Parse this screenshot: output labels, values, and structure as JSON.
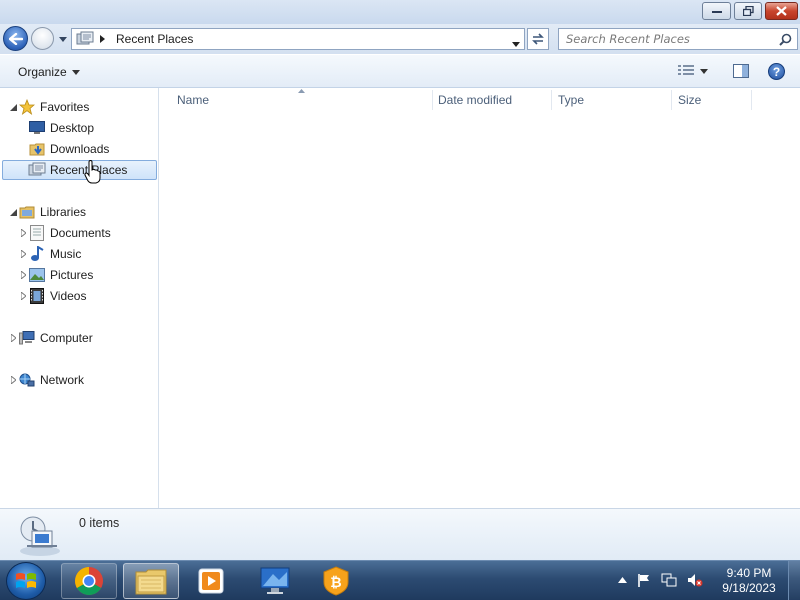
{
  "window": {
    "controls": [
      "minimize",
      "maximize",
      "close"
    ]
  },
  "navigation": {
    "address_path": "Recent Places",
    "search_placeholder": "Search Recent Places"
  },
  "command_bar": {
    "organize_label": "Organize"
  },
  "nav_pane": {
    "favorites_label": "Favorites",
    "favorites": [
      "Desktop",
      "Downloads",
      "Recent Places"
    ],
    "libraries_label": "Libraries",
    "libraries": [
      "Documents",
      "Music",
      "Pictures",
      "Videos"
    ],
    "computer_label": "Computer",
    "network_label": "Network",
    "selected": "Recent Places"
  },
  "file_list": {
    "columns": [
      "Name",
      "Date modified",
      "Type",
      "Size"
    ],
    "items": []
  },
  "details": {
    "item_count": "0 items"
  },
  "taskbar": {
    "apps": [
      "chrome-icon",
      "file-explorer-icon",
      "media-player-icon",
      "remote-desktop-icon",
      "bitcoin-wallet-icon"
    ],
    "active_app": "file-explorer-icon",
    "clock_time": "9:40 PM",
    "clock_date": "9/18/2023"
  },
  "colors": {
    "accent": "#2d62b8",
    "selection": "#cfe3fa",
    "taskbar": "#2c4b72"
  }
}
